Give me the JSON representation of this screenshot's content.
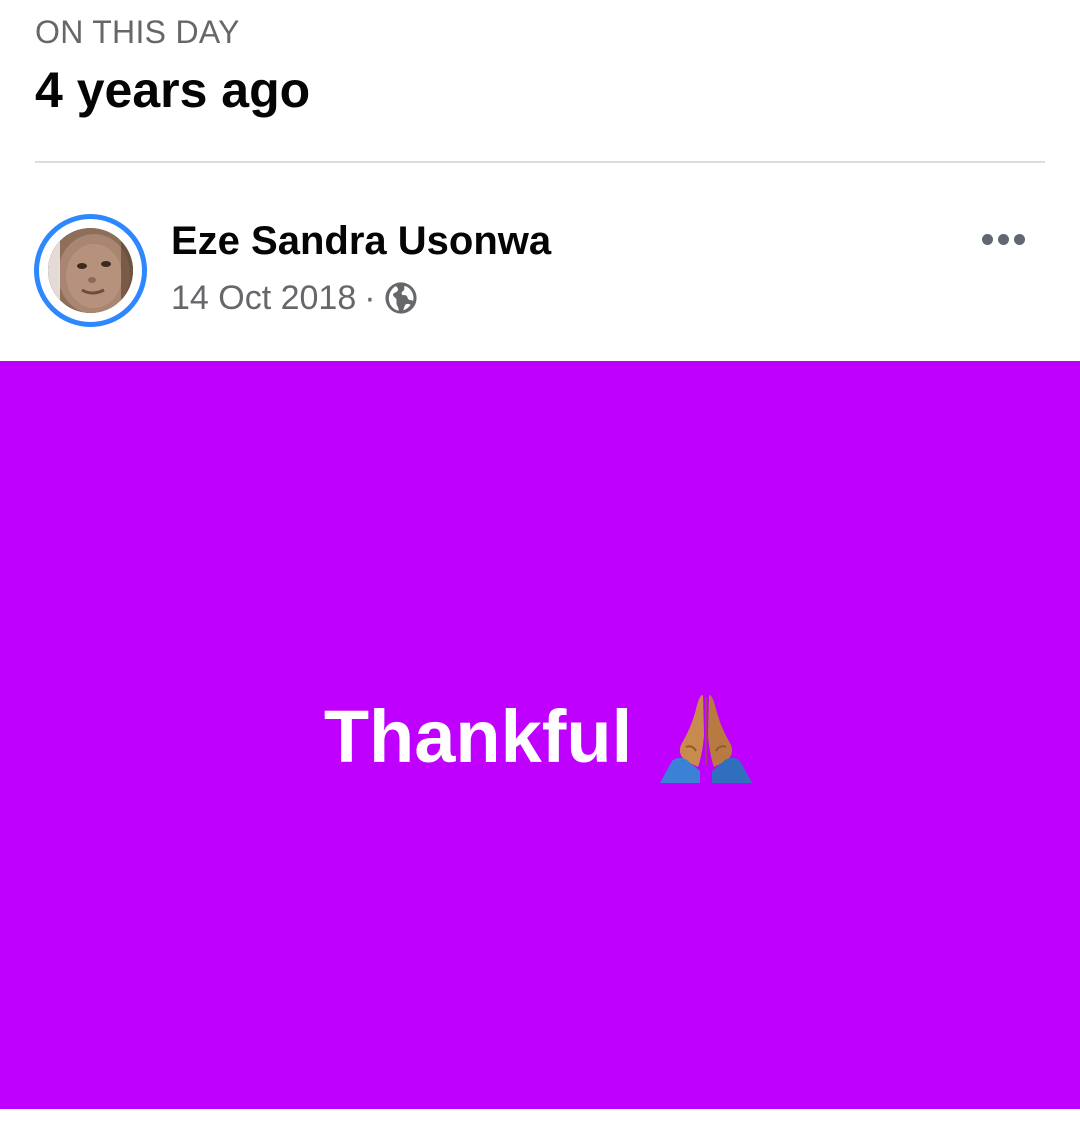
{
  "memory": {
    "label": "ON THIS DAY",
    "title": "4 years ago"
  },
  "post": {
    "author": "Eze Sandra Usonwa",
    "date": "14 Oct 2018",
    "separator": "·",
    "audience_icon": "globe-icon",
    "more_icon": "more-options-icon",
    "text": "Thankful",
    "emoji_icon": "folded-hands-icon",
    "background_color": "#c000ff"
  },
  "colors": {
    "avatar_ring": "#2d88ff",
    "secondary_text": "#65676b",
    "divider": "#dadde1"
  }
}
